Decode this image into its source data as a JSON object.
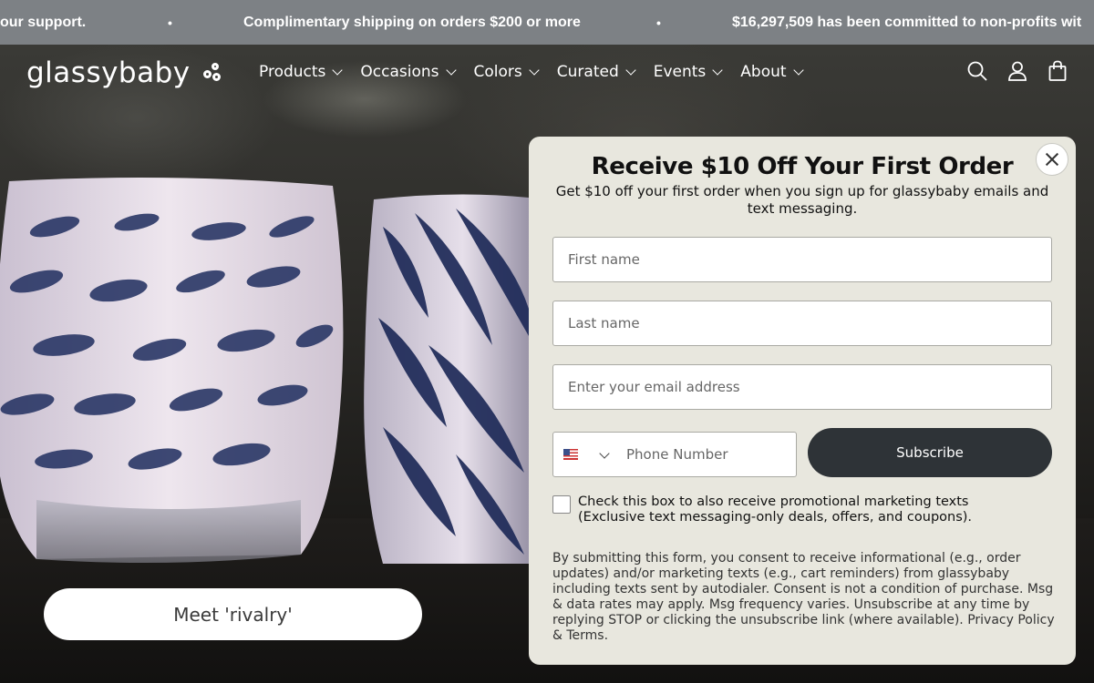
{
  "announcement": {
    "left_fragment": "our support.",
    "center": "Complimentary shipping on orders $200 or more",
    "right_fragment": "$16,297,509 has been committed to non-profits wit",
    "separator": "•"
  },
  "brand": {
    "name": "glassybaby"
  },
  "nav": {
    "items": [
      {
        "label": "Products"
      },
      {
        "label": "Occasions"
      },
      {
        "label": "Colors"
      },
      {
        "label": "Curated"
      },
      {
        "label": "Events"
      },
      {
        "label": "About"
      }
    ]
  },
  "header_icons": [
    "search-icon",
    "account-icon",
    "bag-icon"
  ],
  "hero": {
    "button_label": "Meet 'rivalry'"
  },
  "popup": {
    "title": "Receive $10 Off Your First Order",
    "subtitle": "Get $10 off your first order when you sign up for glassybaby emails and text messaging.",
    "fields": {
      "first_name_placeholder": "First name",
      "last_name_placeholder": "Last name",
      "email_placeholder": "Enter your email address",
      "phone_placeholder": "Phone Number"
    },
    "subscribe_label": "Subscribe",
    "checkbox_label": "Check this box to also receive promotional marketing texts (Exclusive text messaging-only deals, offers, and coupons).",
    "disclaimer": "By submitting this form, you consent to receive informational (e.g., order updates) and/or marketing texts (e.g., cart reminders) from glassybaby including texts sent by autodialer. Consent is not a condition of purchase. Msg & data rates may apply. Msg frequency varies. Unsubscribe at any time by replying STOP or clicking the unsubscribe link (where available).",
    "privacy_link": "Privacy Policy",
    "terms_separator": "&",
    "terms_link": "Terms."
  },
  "colors": {
    "announcement_bg": "#7d8185",
    "popup_bg": "#e8e7de",
    "subscribe_bg": "#2e3337"
  }
}
